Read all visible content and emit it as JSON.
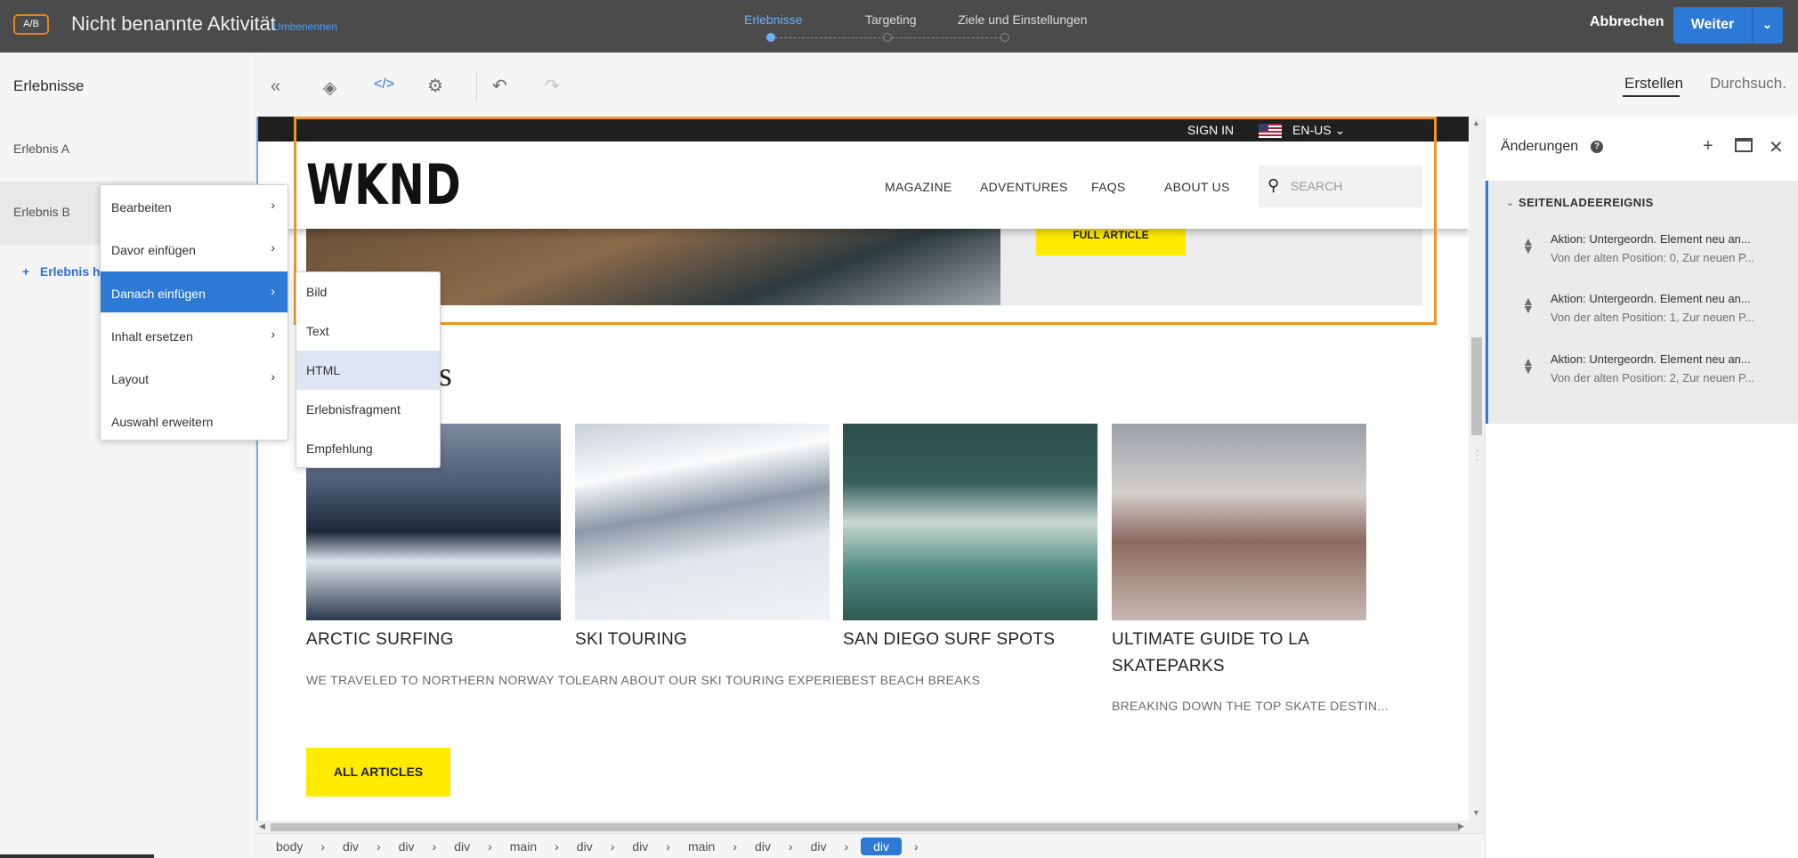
{
  "topbar": {
    "badge": "A/B",
    "title": "Nicht benannte Aktivität",
    "rename": "Umbenennen",
    "steps": [
      "Erlebnisse",
      "Targeting",
      "Ziele und Einstellungen"
    ],
    "active_step": "Erlebnisse",
    "cancel": "Abbrechen",
    "next": "Weiter"
  },
  "left_panel": {
    "title": "Erlebnisse",
    "items": [
      "Erlebnis A",
      "Erlebnis B"
    ],
    "add_label": "Erlebnis hi"
  },
  "toolbar": {
    "icons": [
      "collapse-left-icon",
      "layers-icon",
      "code-icon",
      "gear-icon",
      "undo-icon",
      "redo-icon"
    ],
    "tabs": [
      "Erstellen",
      "Durchsuch."
    ]
  },
  "site": {
    "sign_in": "SIGN IN",
    "lang": "EN-US",
    "logo": "WKND",
    "nav": [
      "MAGAZINE",
      "ADVENTURES",
      "FAQS",
      "ABOUT US"
    ],
    "search_placeholder": "SEARCH",
    "hero_button": "FULL ARTICLE",
    "section_title": "rticles",
    "articles": [
      {
        "title": "ARCTIC SURFING",
        "desc": "WE TRAVELED TO NORTHERN NORWAY TO..."
      },
      {
        "title": "SKI TOURING",
        "desc": "LEARN ABOUT OUR SKI TOURING EXPERIE..."
      },
      {
        "title": "SAN DIEGO SURF SPOTS",
        "desc": "BEST BEACH BREAKS"
      },
      {
        "title": "ULTIMATE GUIDE TO LA SKATEPARKS",
        "desc": "BREAKING DOWN THE TOP SKATE DESTIN..."
      }
    ],
    "all_articles": "ALL ARTICLES"
  },
  "breadcrumb": [
    "body",
    "div",
    "div",
    "div",
    "main",
    "div",
    "div",
    "main",
    "div",
    "div",
    "div"
  ],
  "right_panel": {
    "title": "Änderungen",
    "section": "SEITENLADEEREIGNIS",
    "changes": [
      {
        "action": "Aktion: Untergeordn. Element neu an...",
        "detail": "Von der alten Position: 0, Zur neuen P..."
      },
      {
        "action": "Aktion: Untergeordn. Element neu an...",
        "detail": "Von der alten Position: 1, Zur neuen P..."
      },
      {
        "action": "Aktion: Untergeordn. Element neu an...",
        "detail": "Von der alten Position: 2, Zur neuen P..."
      }
    ]
  },
  "context_menu": {
    "items": [
      "Bearbeiten",
      "Davor einfügen",
      "Danach einfügen",
      "Inhalt ersetzen",
      "Layout",
      "Auswahl erweitern"
    ],
    "active": "Danach einfügen"
  },
  "submenu": {
    "items": [
      "Bild",
      "Text",
      "HTML",
      "Erlebnisfragment",
      "Empfehlung"
    ],
    "hover": "HTML"
  },
  "colors": {
    "topbar_bg": "#4b4b4b",
    "accent_blue": "#2d7ad6",
    "selection_orange": "#f29423",
    "wknd_yellow": "#ffea00"
  }
}
